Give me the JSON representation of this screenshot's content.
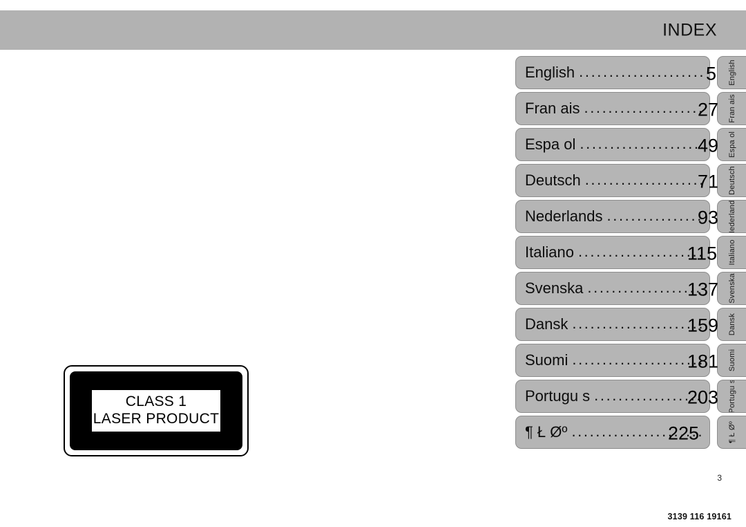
{
  "header": {
    "title": "INDEX",
    "band_color": "#b2b2b2"
  },
  "index": {
    "row_fill_color": "#b5b5b5",
    "row_border_color": "#8d8d8d",
    "rows": [
      {
        "label": "English",
        "page": "5",
        "tab": "English"
      },
      {
        "label": "Fran ais",
        "page": "27",
        "tab": "Fran ais"
      },
      {
        "label": "Espa ol",
        "page": "49",
        "tab": "Espa ol"
      },
      {
        "label": "Deutsch",
        "page": "71",
        "tab": "Deutsch"
      },
      {
        "label": "Nederlands",
        "page": "93",
        "tab": "Nederlands"
      },
      {
        "label": "Italiano",
        "page": "115",
        "tab": "Italiano"
      },
      {
        "label": "Svenska",
        "page": "137",
        "tab": "Svenska"
      },
      {
        "label": "Dansk",
        "page": "159",
        "tab": "Dansk"
      },
      {
        "label": "Suomi",
        "page": "181",
        "tab": "Suomi"
      },
      {
        "label": "Portugu s",
        "page": "203",
        "tab": "Portugu s"
      },
      {
        "label": "¶ Ł Øº",
        "page": "225",
        "tab": "¶ Ł Øº"
      }
    ]
  },
  "laser_label": {
    "line1": "CLASS 1",
    "line2": "LASER PRODUCT"
  },
  "footer": {
    "page_number": "3",
    "doc_code": "3139 116 19161"
  }
}
